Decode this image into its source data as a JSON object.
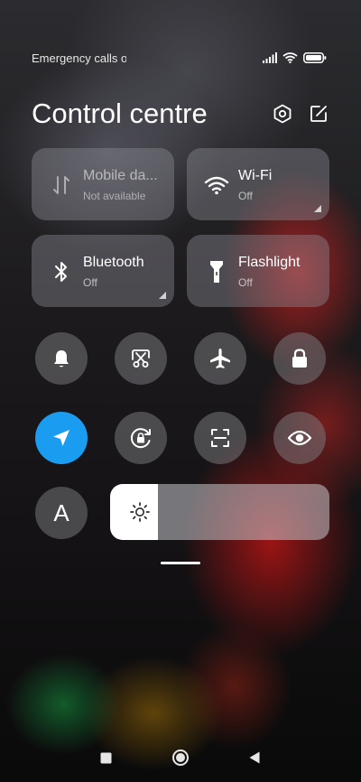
{
  "status_bar": {
    "text": "Emergency calls o"
  },
  "header": {
    "title": "Control centre",
    "settings_icon": "settings-hex-icon",
    "edit_icon": "edit-icon"
  },
  "tiles": {
    "mobile_data": {
      "label": "Mobile da...",
      "status": "Not available",
      "icon": "mobile-data-arrows-icon"
    },
    "wifi": {
      "label": "Wi-Fi",
      "status": "Off",
      "icon": "wifi-icon"
    },
    "bluetooth": {
      "label": "Bluetooth",
      "status": "Off",
      "icon": "bluetooth-icon"
    },
    "flashlight": {
      "label": "Flashlight",
      "status": "Off",
      "icon": "flashlight-icon"
    }
  },
  "quick_toggles": [
    {
      "icon": "bell-icon",
      "active": false
    },
    {
      "icon": "screenshot-scissors-icon",
      "active": false
    },
    {
      "icon": "airplane-icon",
      "active": false
    },
    {
      "icon": "lock-icon",
      "active": false
    },
    {
      "icon": "location-arrow-icon",
      "active": true
    },
    {
      "icon": "rotation-lock-icon",
      "active": false
    },
    {
      "icon": "scanner-icon",
      "active": false
    },
    {
      "icon": "eye-icon",
      "active": false
    }
  ],
  "auto_brightness": {
    "label": "A"
  },
  "brightness": {
    "level_percent": 22,
    "icon": "sun-icon"
  },
  "colors": {
    "accent": "#1a9df0"
  }
}
